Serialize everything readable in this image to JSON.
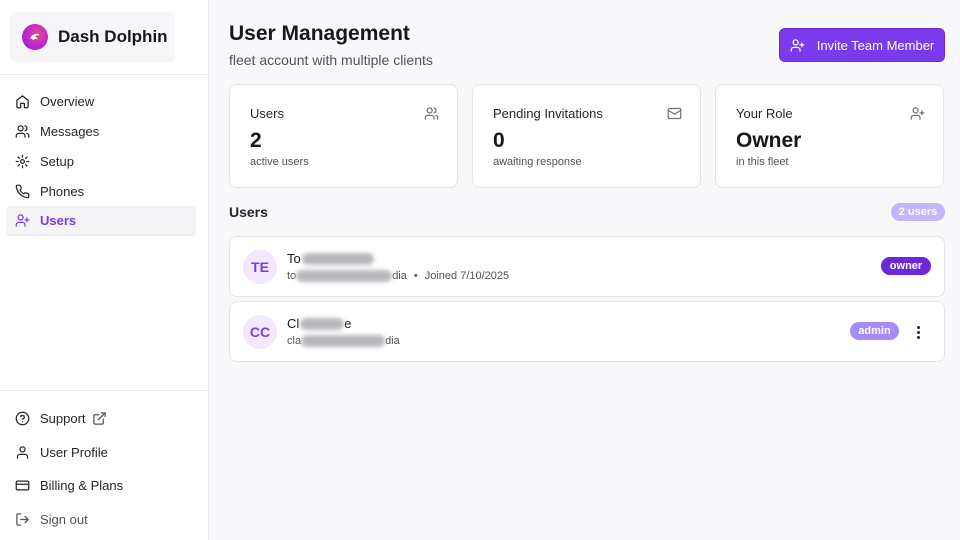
{
  "brand": {
    "name": "Dash Dolphin"
  },
  "nav": {
    "items": [
      {
        "label": "Overview",
        "icon": "home-icon"
      },
      {
        "label": "Messages",
        "icon": "users-icon"
      },
      {
        "label": "Setup",
        "icon": "gear-icon"
      },
      {
        "label": "Phones",
        "icon": "phone-icon"
      },
      {
        "label": "Users",
        "icon": "user-plus-icon",
        "active": true
      }
    ],
    "bottom": [
      {
        "label": "Support",
        "icon": "help-circle-icon"
      },
      {
        "label": "User Profile",
        "icon": "user-icon"
      },
      {
        "label": "Billing & Plans",
        "icon": "credit-card-icon"
      },
      {
        "label": "Sign out",
        "icon": "logout-icon"
      }
    ]
  },
  "header": {
    "title": "User Management",
    "subtitle": "fleet account with multiple clients",
    "invite_label": "Invite Team Member"
  },
  "stats": [
    {
      "title": "Users",
      "value": "2",
      "sub": "active users",
      "icon": "users-icon"
    },
    {
      "title": "Pending Invitations",
      "value": "0",
      "sub": "awaiting response",
      "icon": "mail-icon"
    },
    {
      "title": "Your Role",
      "value": "Owner",
      "sub": "in this fleet",
      "icon": "user-plus-icon"
    }
  ],
  "users_section": {
    "title": "Users",
    "count_label": "2 users",
    "rows": [
      {
        "initials": "TE",
        "name_visible": "To",
        "email_visible_start": "to",
        "email_visible_end": "dia",
        "joined": "Joined 7/10/2025",
        "role": "owner"
      },
      {
        "initials": "CC",
        "name_visible": "Cl",
        "name_visible_end": "e",
        "email_visible_start": "cla",
        "email_visible_end": "dia",
        "role": "admin"
      }
    ]
  },
  "colors": {
    "accent": "#7c3aed",
    "owner_badge": "#6d28d9",
    "admin_badge": "#a78bfa",
    "count_badge": "#c4b5fd"
  }
}
